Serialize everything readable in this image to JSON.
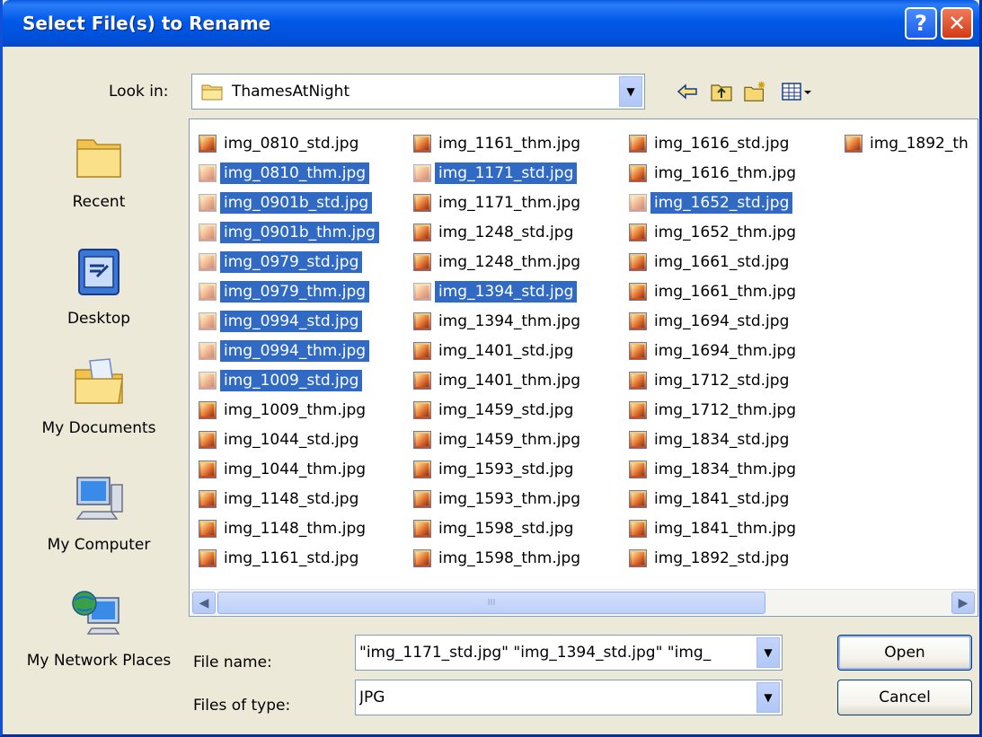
{
  "window": {
    "title": "Select File(s) to Rename",
    "help_glyph": "?",
    "close_glyph": "✕"
  },
  "lookin": {
    "label": "Look in:",
    "value": "ThamesAtNight"
  },
  "places": [
    {
      "label": "Recent",
      "icon": "recent-folder-icon"
    },
    {
      "label": "Desktop",
      "icon": "desktop-icon"
    },
    {
      "label": "My Documents",
      "icon": "my-documents-icon"
    },
    {
      "label": "My Computer",
      "icon": "my-computer-icon"
    },
    {
      "label": "My Network Places",
      "icon": "network-places-icon"
    }
  ],
  "files": {
    "columns": [
      [
        {
          "name": "img_0810_std.jpg",
          "selected": false
        },
        {
          "name": "img_0810_thm.jpg",
          "selected": true
        },
        {
          "name": "img_0901b_std.jpg",
          "selected": true
        },
        {
          "name": "img_0901b_thm.jpg",
          "selected": true
        },
        {
          "name": "img_0979_std.jpg",
          "selected": true
        },
        {
          "name": "img_0979_thm.jpg",
          "selected": true
        },
        {
          "name": "img_0994_std.jpg",
          "selected": true
        },
        {
          "name": "img_0994_thm.jpg",
          "selected": true
        },
        {
          "name": "img_1009_std.jpg",
          "selected": true
        },
        {
          "name": "img_1009_thm.jpg",
          "selected": false
        },
        {
          "name": "img_1044_std.jpg",
          "selected": false
        },
        {
          "name": "img_1044_thm.jpg",
          "selected": false
        },
        {
          "name": "img_1148_std.jpg",
          "selected": false
        },
        {
          "name": "img_1148_thm.jpg",
          "selected": false
        },
        {
          "name": "img_1161_std.jpg",
          "selected": false
        }
      ],
      [
        {
          "name": "img_1161_thm.jpg",
          "selected": false
        },
        {
          "name": "img_1171_std.jpg",
          "selected": true
        },
        {
          "name": "img_1171_thm.jpg",
          "selected": false
        },
        {
          "name": "img_1248_std.jpg",
          "selected": false
        },
        {
          "name": "img_1248_thm.jpg",
          "selected": false
        },
        {
          "name": "img_1394_std.jpg",
          "selected": true
        },
        {
          "name": "img_1394_thm.jpg",
          "selected": false
        },
        {
          "name": "img_1401_std.jpg",
          "selected": false
        },
        {
          "name": "img_1401_thm.jpg",
          "selected": false
        },
        {
          "name": "img_1459_std.jpg",
          "selected": false
        },
        {
          "name": "img_1459_thm.jpg",
          "selected": false
        },
        {
          "name": "img_1593_std.jpg",
          "selected": false
        },
        {
          "name": "img_1593_thm.jpg",
          "selected": false
        },
        {
          "name": "img_1598_std.jpg",
          "selected": false
        },
        {
          "name": "img_1598_thm.jpg",
          "selected": false
        }
      ],
      [
        {
          "name": "img_1616_std.jpg",
          "selected": false
        },
        {
          "name": "img_1616_thm.jpg",
          "selected": false
        },
        {
          "name": "img_1652_std.jpg",
          "selected": true
        },
        {
          "name": "img_1652_thm.jpg",
          "selected": false
        },
        {
          "name": "img_1661_std.jpg",
          "selected": false
        },
        {
          "name": "img_1661_thm.jpg",
          "selected": false
        },
        {
          "name": "img_1694_std.jpg",
          "selected": false
        },
        {
          "name": "img_1694_thm.jpg",
          "selected": false
        },
        {
          "name": "img_1712_std.jpg",
          "selected": false
        },
        {
          "name": "img_1712_thm.jpg",
          "selected": false
        },
        {
          "name": "img_1834_std.jpg",
          "selected": false
        },
        {
          "name": "img_1834_thm.jpg",
          "selected": false
        },
        {
          "name": "img_1841_std.jpg",
          "selected": false
        },
        {
          "name": "img_1841_thm.jpg",
          "selected": false
        },
        {
          "name": "img_1892_std.jpg",
          "selected": false
        }
      ],
      [
        {
          "name": "img_1892_th",
          "selected": false
        }
      ]
    ],
    "scroll_thumb_grip": "III"
  },
  "filename": {
    "label": "File name:",
    "value": "\"img_1171_std.jpg\" \"img_1394_std.jpg\" \"img_"
  },
  "filetype": {
    "label": "Files of type:",
    "value": "JPG"
  },
  "buttons": {
    "open": "Open",
    "cancel": "Cancel"
  },
  "colors": {
    "selection": "#316ac5",
    "titlebar": "#0058e8",
    "dialog_bg": "#ece9d8"
  }
}
